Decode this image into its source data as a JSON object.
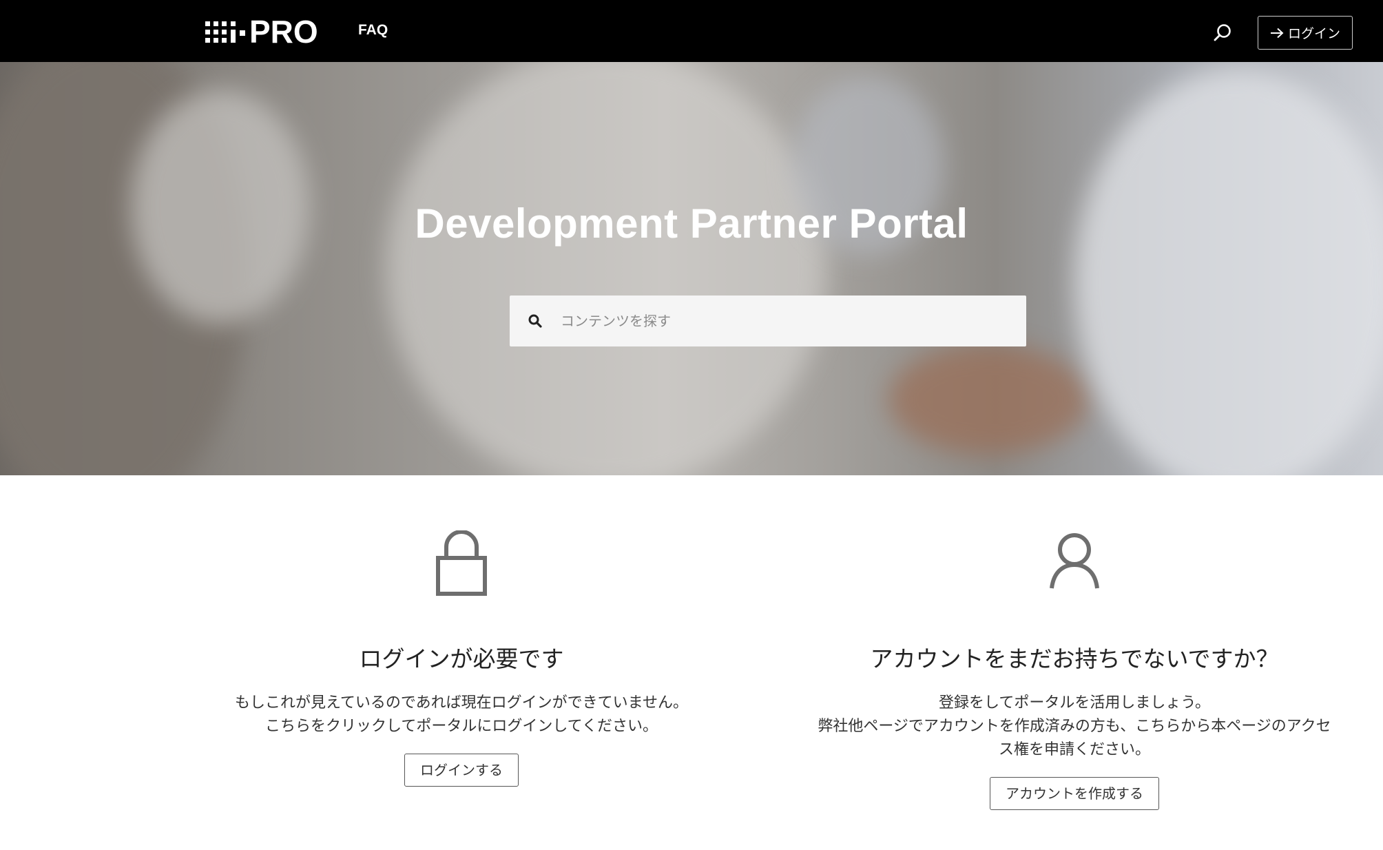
{
  "header": {
    "logo_text": "PRO",
    "nav_faq": "FAQ",
    "search_icon": "search-icon",
    "login_label": "ログイン",
    "background": "#000000"
  },
  "hero": {
    "title": "Development Partner Portal",
    "search_placeholder": "コンテンツを探す"
  },
  "cards": {
    "login": {
      "icon": "lock-icon",
      "heading": "ログインが必要です",
      "desc_line1": "もしこれが見えているのであれば現在ログインができていません。",
      "desc_line2": "こちらをクリックしてポータルにログインしてください。",
      "button": "ログインする"
    },
    "signup": {
      "icon": "user-icon",
      "heading": "アカウントをまだお持ちでないですか？",
      "desc_line1": "登録をしてポータルを活用しましょう。",
      "desc_line2": "弊社他ページでアカウントを作成済みの方も、こちらから本ページのアクセ",
      "desc_line3": "ス権を申請ください。",
      "button": "アカウントを作成する"
    }
  }
}
